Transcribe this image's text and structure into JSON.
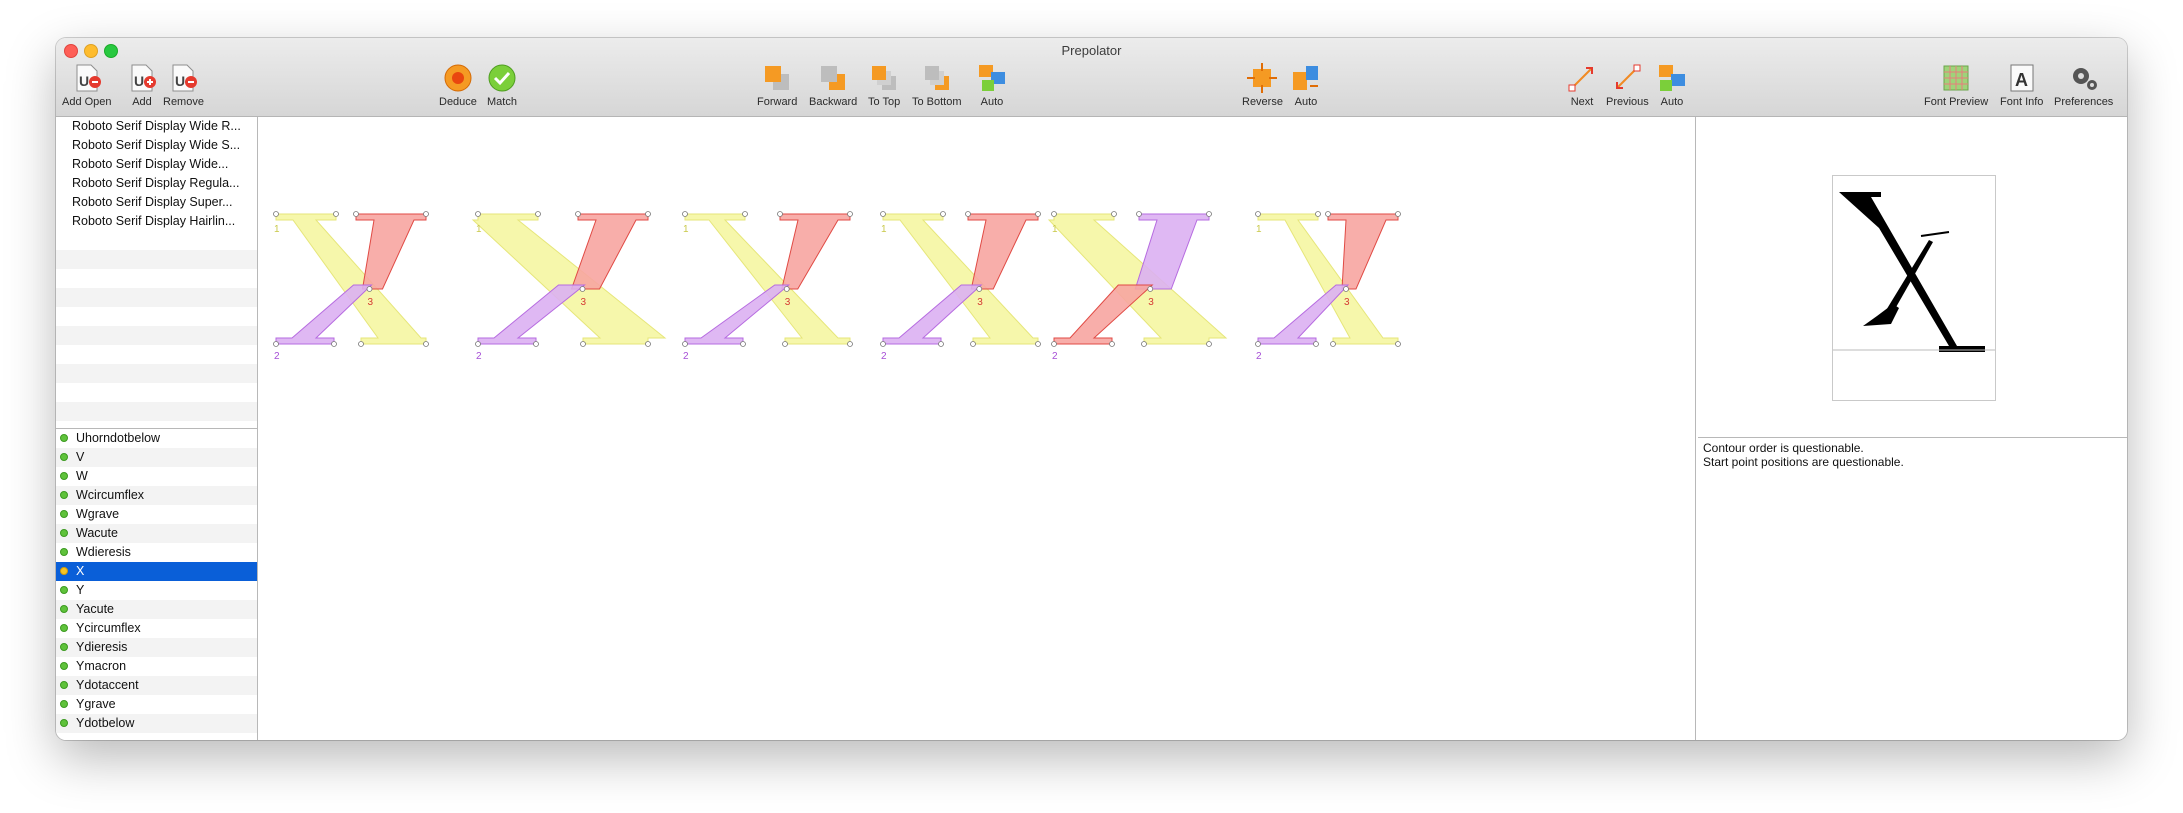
{
  "window": {
    "title": "Prepolator"
  },
  "toolbar": {
    "add_open": "Add Open",
    "add": "Add",
    "remove": "Remove",
    "deduce": "Deduce",
    "match": "Match",
    "forward": "Forward",
    "backward": "Backward",
    "to_top": "To Top",
    "to_bottom": "To Bottom",
    "auto1": "Auto",
    "reverse": "Reverse",
    "auto2": "Auto",
    "next": "Next",
    "previous": "Previous",
    "auto3": "Auto",
    "font_preview": "Font Preview",
    "font_info": "Font Info",
    "preferences": "Preferences"
  },
  "fonts": [
    "Roboto Serif Display Wide R...",
    "Roboto Serif Display Wide S...",
    "Roboto Serif Display Wide...",
    "Roboto Serif Display Regula...",
    "Roboto Serif Display Super...",
    "Roboto Serif Display Hairlin..."
  ],
  "glyphs": [
    "Uhorndotbelow",
    "V",
    "W",
    "Wcircumflex",
    "Wgrave",
    "Wacute",
    "Wdieresis",
    "X",
    "Y",
    "Yacute",
    "Ycircumflex",
    "Ydieresis",
    "Ymacron",
    "Ydotaccent",
    "Ygrave",
    "Ydotbelow"
  ],
  "selected_glyph": "X",
  "contour_labels": {
    "one": "1",
    "two": "2",
    "three": "3"
  },
  "messages": {
    "line1": "Contour order is questionable.",
    "line2": "Start point positions are questionable."
  },
  "colors": {
    "contour1": "#f6f7a6",
    "contour2": "#dcb0f2",
    "contour3": "#f7a5a1",
    "selection": "#0a5fd8"
  }
}
